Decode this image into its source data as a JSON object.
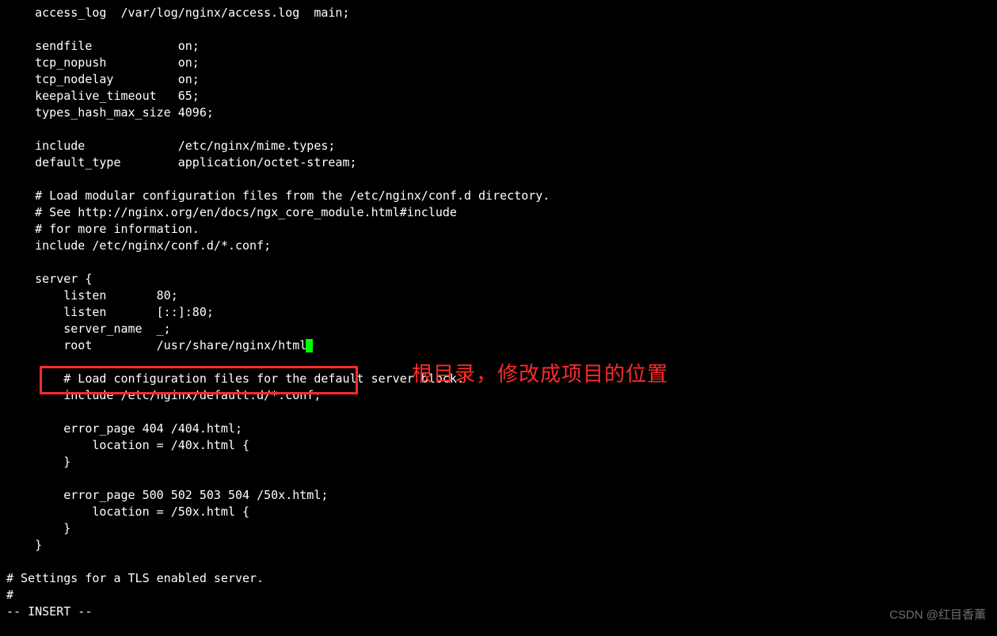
{
  "config": {
    "lines": [
      "    access_log  /var/log/nginx/access.log  main;",
      "",
      "    sendfile            on;",
      "    tcp_nopush          on;",
      "    tcp_nodelay         on;",
      "    keepalive_timeout   65;",
      "    types_hash_max_size 4096;",
      "",
      "    include             /etc/nginx/mime.types;",
      "    default_type        application/octet-stream;",
      "",
      "    # Load modular configuration files from the /etc/nginx/conf.d directory.",
      "    # See http://nginx.org/en/docs/ngx_core_module.html#include",
      "    # for more information.",
      "    include /etc/nginx/conf.d/*.conf;",
      "",
      "    server {",
      "        listen       80;",
      "        listen       [::]:80;",
      "        server_name  _;",
      "        root         /usr/share/nginx/html;",
      "",
      "        # Load configuration files for the default server block.",
      "        include /etc/nginx/default.d/*.conf;",
      "",
      "        error_page 404 /404.html;",
      "            location = /40x.html {",
      "        }",
      "",
      "        error_page 500 502 503 504 /50x.html;",
      "            location = /50x.html {",
      "        }",
      "    }",
      "",
      "# Settings for a TLS enabled server.",
      "#"
    ],
    "root_line_prefix": "        root         /usr/share/nginx/html",
    "root_line_suffix": ";",
    "cursor_index": 20
  },
  "annotation": "根目录，修改成项目的位置",
  "status_line": "-- INSERT --",
  "watermark": "CSDN @红目香薰"
}
